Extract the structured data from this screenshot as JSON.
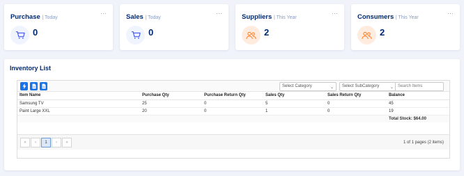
{
  "kpis": [
    {
      "title": "Purchase",
      "period": "| Today",
      "value": "0",
      "icon": "cart-icon",
      "icon_bg": "#f0f4ff",
      "icon_color": "#4154f1"
    },
    {
      "title": "Sales",
      "period": "| Today",
      "value": "0",
      "icon": "cart-icon",
      "icon_bg": "#f0f4ff",
      "icon_color": "#4154f1"
    },
    {
      "title": "Suppliers",
      "period": "| This Year",
      "value": "2",
      "icon": "people-icon",
      "icon_bg": "#ffecdf",
      "icon_color": "#ff771d"
    },
    {
      "title": "Consumers",
      "period": "| This Year",
      "value": "2",
      "icon": "people-icon",
      "icon_bg": "#ffecdf",
      "icon_color": "#ff771d"
    }
  ],
  "more_label": "···",
  "inventory": {
    "title": "Inventory List",
    "category_placeholder": "Select Category",
    "subcategory_placeholder": "Select SubCategory",
    "search_placeholder": "Search Items",
    "columns": [
      "Item Name",
      "Purchase Qty",
      "Purchase Return Qty",
      "Sales Qty",
      "Sales Return Qty",
      "Balance"
    ],
    "rows": [
      [
        "Samsung TV",
        "25",
        "0",
        "5",
        "0",
        "45"
      ],
      [
        "Paint Large XXL",
        "20",
        "0",
        "1",
        "0",
        "19"
      ]
    ],
    "total_stock": "Total Stock: $64.00",
    "pager": {
      "first": "«",
      "prev": "‹",
      "page": "1",
      "next": "›",
      "last": "»",
      "info": "1 of 1 pages (2 items)"
    }
  },
  "colors": {
    "accent": "#4154f1",
    "orange": "#ff771d",
    "title": "#012970",
    "toolbar_button": "#1a73e8"
  }
}
